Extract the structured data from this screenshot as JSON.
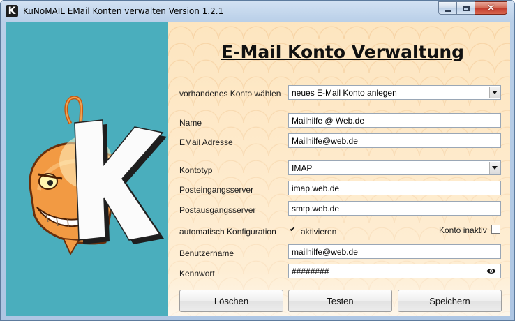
{
  "window": {
    "title": "KuNoMAIL EMail Konten verwalten Version 1.2.1",
    "app_icon_letter": "K"
  },
  "form": {
    "heading": "E-Mail Konto Verwaltung",
    "account_label": "vorhandenes Konto wählen",
    "account_value": "neues E-Mail Konto anlegen",
    "name_label": "Name",
    "name_value": "Mailhilfe @ Web.de",
    "email_label": "EMail Adresse",
    "email_value": "Mailhilfe@web.de",
    "type_label": "Kontotyp",
    "type_value": "IMAP",
    "incoming_label": "Posteingangsserver",
    "incoming_value": "imap.web.de",
    "outgoing_label": "Postausgangsserver",
    "outgoing_value": "smtp.web.de",
    "autoconfig_label": "automatisch Konfiguration",
    "autoconfig_checkbox_label": "aktivieren",
    "autoconfig_checked": true,
    "inactive_label": "Konto inaktiv",
    "inactive_checked": false,
    "username_label": "Benutzername",
    "username_value": "mailhilfe@web.de",
    "password_label": "Kennwort",
    "password_value": "########"
  },
  "buttons": {
    "delete": "Löschen",
    "test": "Testen",
    "save": "Speichern"
  },
  "icons": {
    "app": "kunomail-app-icon",
    "minimize": "minimize-icon",
    "maximize": "maximize-icon",
    "close": "close-icon",
    "dropdown": "chevron-down-icon",
    "eye": "eye-icon",
    "logo": "kunomail-anglerfish-logo"
  },
  "colors": {
    "left_panel": "#4aaebd",
    "right_panel": "#fde2b8",
    "close_button": "#c0392b"
  }
}
